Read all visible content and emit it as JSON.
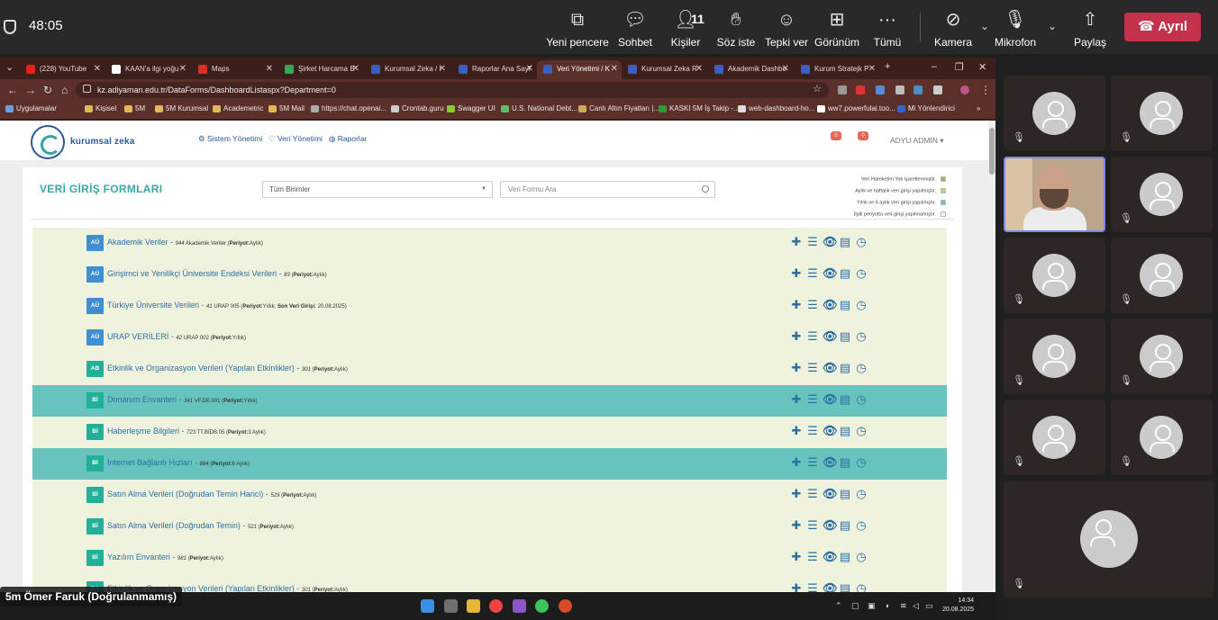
{
  "meeting": {
    "timer": "48:05",
    "buttons": [
      {
        "label": "Yeni pencere",
        "icon": "open-window-icon"
      },
      {
        "label": "Sohbet",
        "icon": "chat-icon"
      },
      {
        "label": "Kişiler",
        "icon": "people-icon",
        "count": "11"
      },
      {
        "label": "Söz iste",
        "icon": "raise-hand-icon"
      },
      {
        "label": "Tepki ver",
        "icon": "smile-icon"
      },
      {
        "label": "Görünüm",
        "icon": "grid-icon"
      },
      {
        "label": "Tümü",
        "icon": "more-icon"
      }
    ],
    "camera_label": "Kamera",
    "mic_label": "Mikrofon",
    "share_label": "Paylaş",
    "leave_label": "Ayrıl",
    "leave_color": "#c4314b",
    "name_tag": "5m Ömer Faruk (Doğrulanmamış)"
  },
  "browser": {
    "tabs": [
      {
        "label": "(228) YouTube",
        "color": "#e62117"
      },
      {
        "label": "KAAN'a ilgi yoğu",
        "color": "#ffffff"
      },
      {
        "label": "Maps",
        "color": "#d93025"
      },
      {
        "label": "Şirket Harcama B",
        "color": "#34a853"
      },
      {
        "label": "Kurumsal Zeka / I",
        "color": "#3b5fc0"
      },
      {
        "label": "Raporlar Ana Sayf",
        "color": "#3b5fc0"
      },
      {
        "label": "Veri Yönetimi / K",
        "color": "#3b5fc0"
      },
      {
        "label": "Kurumsal Zeka R",
        "color": "#3b5fc0"
      },
      {
        "label": "Akademik Dashbo",
        "color": "#3b5fc0"
      },
      {
        "label": "Kurum Stratejk P",
        "color": "#3b5fc0"
      }
    ],
    "active_tab": 6,
    "url": "kz.adiyaman.edu.tr/DataForms/DashboardListaspx?Department=0",
    "bookmarks": [
      "Uygulamalar",
      "Kişisel",
      "5M",
      "5M Kurumsal",
      "Academetric",
      "5M Mail",
      "https://chat.openai...",
      "Crontab.guru",
      "Swagger UI",
      "U.S. National Debt...",
      "Canlı Altın Fiyatları |...",
      "KASKI 5M İş Takip -...",
      "web-dashboard-ho...",
      "ww7.powerfulai.too...",
      "Mi Yönlendirici"
    ]
  },
  "site": {
    "logo_text": "kurumsal zeka",
    "menu": [
      "Sistem Yönetimi",
      "Veri Yönetimi",
      "Raporlar"
    ],
    "notif_counts": [
      "0",
      "0"
    ],
    "user": "ADYU ADMIN",
    "page_title": "VERİ GİRİŞ FORMLARI",
    "filter_value": "Tüm Birimler",
    "search_placeholder": "Veri Formu Ara",
    "legend": [
      {
        "text": "Veri Hareketim Yok işaretlenmiştir.",
        "color": "#8cc63f"
      },
      {
        "text": "Aylık ve haftalık veri girişi yapılmıştır.",
        "color": "#b5d96a"
      },
      {
        "text": "Yıllık ve 6 aylık veri girişi yapılmıştır.",
        "color": "#67c4bd"
      },
      {
        "text": "İlgili periyotta veri girişi yapılmamıştır.",
        "color": "#eff2dc"
      }
    ],
    "rows": [
      {
        "badge": "AÜ",
        "badge_color": "#3f8fd2",
        "title": "Akademik Veriler",
        "code": "944",
        "desc": "Akademik Veriler",
        "period": "Aylık",
        "last": "",
        "highlight": false
      },
      {
        "badge": "AÜ",
        "badge_color": "#3f8fd2",
        "title": "Girişimci ve Yenilikçi Üniversite Endeksi Verileri",
        "code": "83",
        "desc": "",
        "period": "Aylık",
        "last": "",
        "highlight": false
      },
      {
        "badge": "AÜ",
        "badge_color": "#3f8fd2",
        "title": "Türkiye Üniversite Verileri",
        "code": "41",
        "desc": "URAP 005",
        "period": "Yıllık",
        "last": "20.08.2025",
        "highlight": false
      },
      {
        "badge": "AÜ",
        "badge_color": "#3f8fd2",
        "title": "URAP VERİLERİ",
        "code": "42",
        "desc": "URAP 002",
        "period": "Yıllık",
        "last": "",
        "highlight": false
      },
      {
        "badge": "AB",
        "badge_color": "#22b09a",
        "title": "Etkinlik ve Organizasyon Verileri (Yapılan Etkinlikler)",
        "code": "301",
        "desc": "",
        "period": "Aylık",
        "last": "",
        "highlight": false
      },
      {
        "badge": "Bİ",
        "badge_color": "#22b09a",
        "title": "Donanım Envanteri",
        "code": "341",
        "desc": "VF.DE.001",
        "period": "Yıllık",
        "last": "",
        "highlight": true
      },
      {
        "badge": "Bİ",
        "badge_color": "#22b09a",
        "title": "Haberleşme Bilgileri",
        "code": "723",
        "desc": "TT.BİDB.05",
        "period": "3 Aylık",
        "last": "",
        "highlight": false
      },
      {
        "badge": "Bİ",
        "badge_color": "#22b09a",
        "title": "İnternet Bağlantı Hızları",
        "code": "884",
        "desc": "",
        "period": "6 Aylık",
        "last": "",
        "highlight": true
      },
      {
        "badge": "Bİ",
        "badge_color": "#22b09a",
        "title": "Satın Alma Verileri (Doğrudan Temin Harici)",
        "code": "529",
        "desc": "",
        "period": "Aylık",
        "last": "",
        "highlight": false
      },
      {
        "badge": "Bİ",
        "badge_color": "#22b09a",
        "title": "Satın Alma Verileri (Doğrudan Temin)",
        "code": "521",
        "desc": "",
        "period": "Aylık",
        "last": "",
        "highlight": false
      },
      {
        "badge": "Bİ",
        "badge_color": "#22b09a",
        "title": "Yazılım Envanteri",
        "code": "981",
        "desc": "",
        "period": "Aylık",
        "last": "",
        "highlight": false
      },
      {
        "badge": "BA",
        "badge_color": "#22b09a",
        "title": "Etkinlik ve Organizasyon Verileri (Yapılan Etkinlikler)",
        "code": "301",
        "desc": "",
        "period": "Aylık",
        "last": "",
        "highlight": false
      }
    ],
    "row_actions": [
      "plus-icon",
      "list-icon",
      "eye-icon",
      "table-icon",
      "clock-icon"
    ]
  },
  "taskbar": {
    "time": "14:34",
    "date": "20.08.2025"
  }
}
